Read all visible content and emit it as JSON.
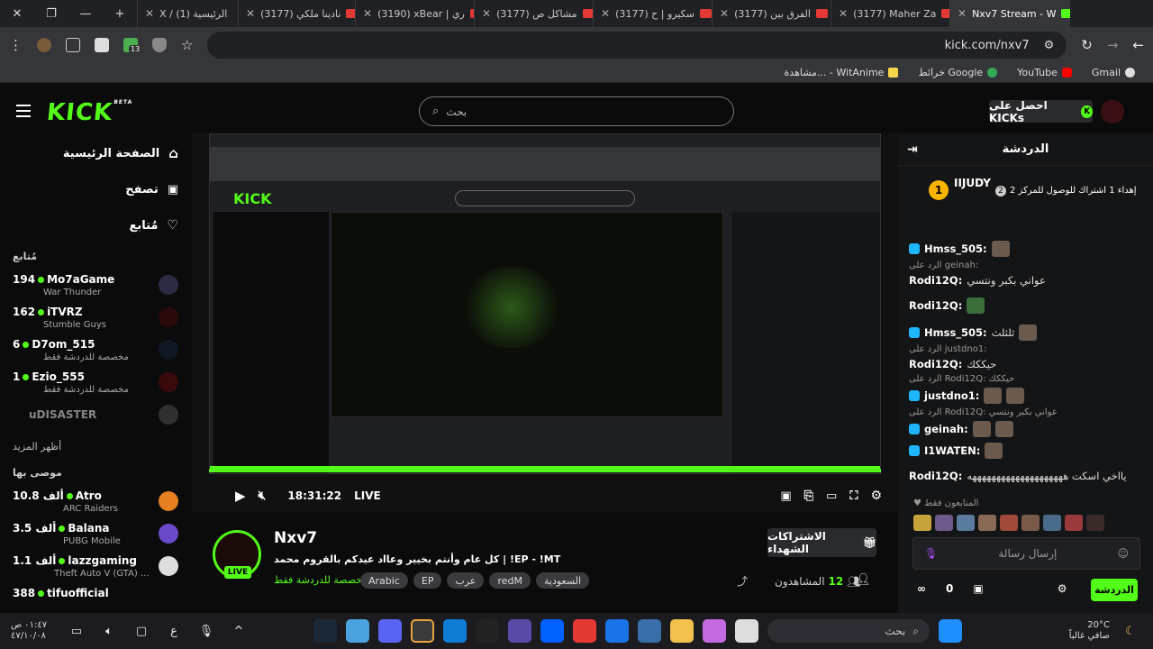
{
  "browser": {
    "tabs": [
      {
        "label": "X / الرئيسية (1)",
        "active": false
      },
      {
        "label": "(3177) نادينا ملكي",
        "active": false
      },
      {
        "label": "(3190) xBear | ري",
        "active": false
      },
      {
        "label": "(3177) مشاكل ص",
        "active": false
      },
      {
        "label": "(3177) سكيرو | ح",
        "active": false
      },
      {
        "label": "(3177) الفرق بين",
        "active": false
      },
      {
        "label": "(3177) Maher Za",
        "active": false
      },
      {
        "label": "Nxv7 Stream - W",
        "active": true
      }
    ],
    "url": "kick.com/nxv7",
    "bookmarks": [
      "Gmail",
      "YouTube",
      "خرائط Google",
      "مشاهدة... - WitAnime"
    ],
    "ext_count": "13"
  },
  "kick": {
    "logo": "KICK",
    "logo_sup": "BETA",
    "search_placeholder": "بحث",
    "get_kicks": "احصل على KICKs",
    "nav": [
      {
        "label": "الصفحة الرئيسية",
        "icon": "home-icon"
      },
      {
        "label": "تصفح",
        "icon": "browse-icon"
      },
      {
        "label": "مُتابع",
        "icon": "heart-icon"
      }
    ],
    "following_title": "مُتابع",
    "following": [
      {
        "count": "194",
        "name": "Mo7aGame",
        "sub": "War Thunder",
        "live": true
      },
      {
        "count": "162",
        "name": "iTVRZ",
        "sub": "Stumble Guys",
        "live": true
      },
      {
        "count": "6",
        "name": "D7om_515",
        "sub": "مخصصة للدردشة فقط",
        "live": true
      },
      {
        "count": "1",
        "name": "Ezio_555",
        "sub": "مخصصة للدردشة فقط",
        "live": true
      },
      {
        "count": "",
        "name": "uDISASTER",
        "sub": "",
        "live": false
      }
    ],
    "show_more": "أظهر المزيد",
    "recommended_title": "موصى بها",
    "recommended": [
      {
        "count": "10.8 ألف",
        "name": "Atro",
        "sub": "ARC Raiders"
      },
      {
        "count": "3.5 ألف",
        "name": "Balana",
        "sub": "PUBG Mobile"
      },
      {
        "count": "1.1 ألف",
        "name": "lazzgaming",
        "sub": "Theft Auto V (GTA) ..."
      },
      {
        "count": "388",
        "name": "tifuofficial",
        "sub": ""
      }
    ]
  },
  "player": {
    "time": "18:31:22",
    "live": "LIVE"
  },
  "stream": {
    "name": "Nxv7",
    "title": "كل عام وأنتم بخيير وعااد عيدكم بالقروم محمد | !EP - !MT",
    "category": "مخصصة للدردشة فقط",
    "tags": [
      "Arabic",
      "EP",
      "عرب",
      "redM",
      "السعودية"
    ],
    "live_badge": "LIVE",
    "subs_button": "الاشتراكات الشهداء",
    "viewers_label": "المشاهدون",
    "viewers": "12"
  },
  "chat": {
    "title": "الدردشة",
    "pinned_user": "IIJUDY",
    "pinned_text": "إهداء 1 اشتراك للوصول للمركز 2",
    "pinned_rank": "2",
    "pinned_level": "1",
    "messages": [
      {
        "user": "Hmss_505:",
        "text": "",
        "reply": ""
      },
      {
        "user": "Rodi12Q:",
        "text": "عواني بكبر ونتسي",
        "reply": "الرد على geinah:"
      },
      {
        "user": "Rodi12Q:",
        "text": "",
        "reply": ""
      },
      {
        "user": "Hmss_505:",
        "text": "ثلثلث",
        "reply": ""
      },
      {
        "user": "Rodi12Q:",
        "text": "حيككك",
        "reply": "الرد على justdno1:"
      },
      {
        "user": "justdno1:",
        "text": "",
        "reply": "الرد على Rodi12Q: حيككك"
      },
      {
        "user": "geinah:",
        "text": "",
        "reply": "الرد على Rodi12Q: عواني بكبر ونتسي"
      },
      {
        "user": "I1WATEN:",
        "text": "",
        "reply": ""
      },
      {
        "user": "Rodi12Q:",
        "text": "يااخي اسكت ههههههههههههههههههههه",
        "reply": ""
      }
    ],
    "followers_only": "المتابعون فقط",
    "input_placeholder": "إرسال رسالة",
    "send_button": "الدردشة",
    "points": "0"
  },
  "taskbar": {
    "search": "بحث",
    "weather_temp": "20°C",
    "weather_desc": "صافي غالباً",
    "time": "٠١:٤٧ ص",
    "date": "٤٧/١٠/٠٨"
  }
}
